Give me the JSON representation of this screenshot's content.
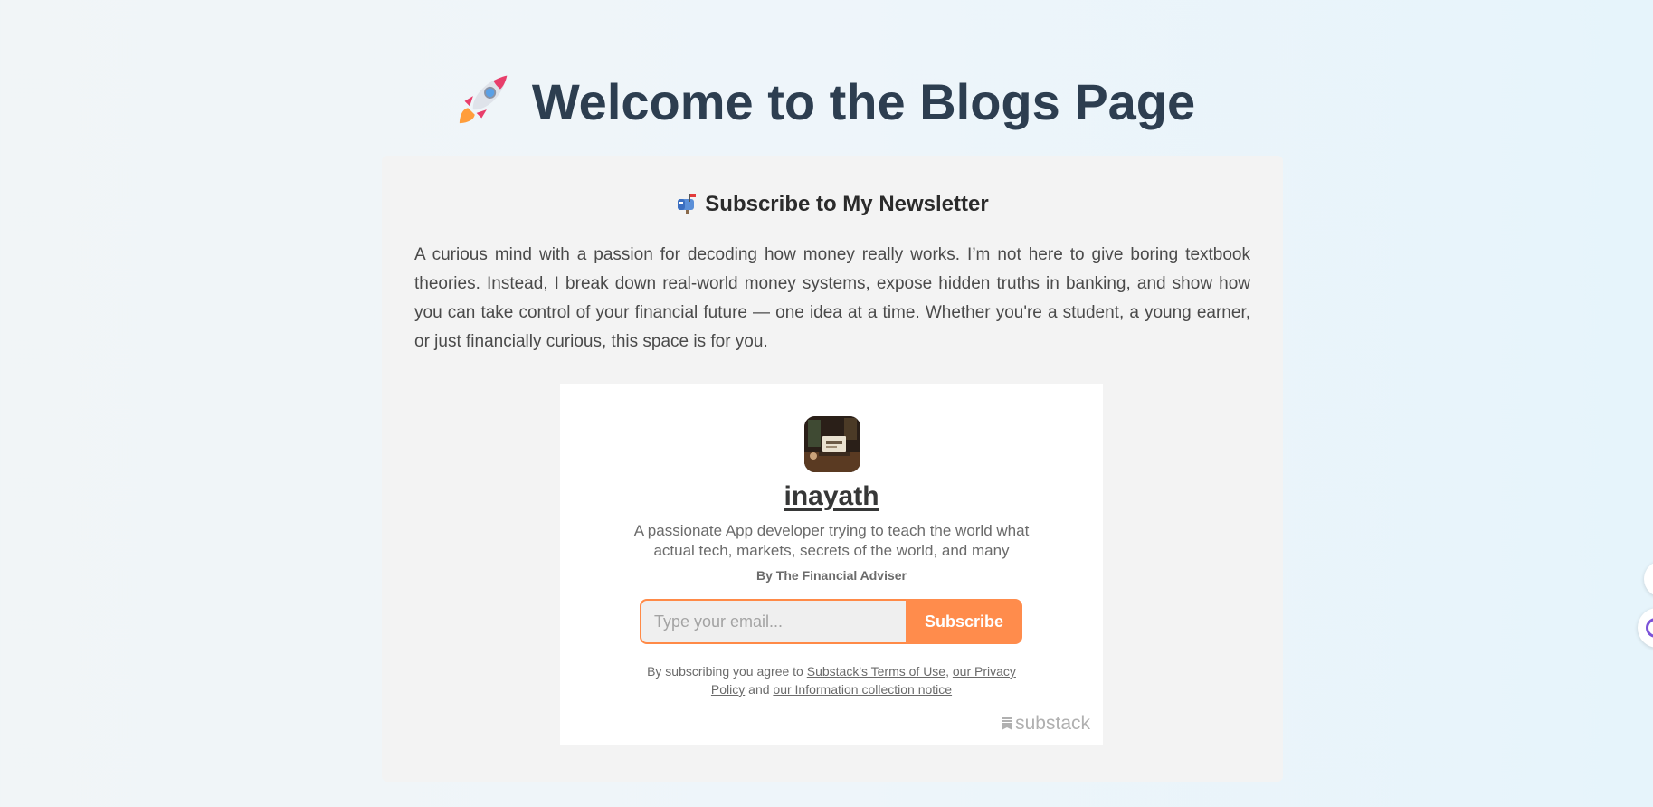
{
  "page": {
    "title": "Welcome to the Blogs Page",
    "title_icon": "rocket-icon"
  },
  "newsletter": {
    "heading": "Subscribe to My Newsletter",
    "heading_icon": "mailbox-icon",
    "description": "A curious mind with a passion for decoding how money really works. I’m not here to give boring textbook theories. Instead, I break down real-world money systems, expose hidden truths in banking, and show how you can take control of your financial future — one idea at a time. Whether you're a student, a young earner, or just financially curious, this space is for you."
  },
  "embed": {
    "publication_name": "inayath",
    "publication_description": "A passionate App developer trying to teach the world what actual tech, markets, secrets of the world, and many",
    "author_line": "By The Financial Adviser",
    "email_placeholder": "Type your email...",
    "subscribe_label": "Subscribe",
    "terms": {
      "prefix": "By subscribing you agree to ",
      "terms_link": "Substack's Terms of Use",
      "comma": ", ",
      "privacy_link": "our Privacy Policy",
      "and": " and ",
      "notice_link": "our Information collection notice"
    },
    "brand": "substack"
  },
  "colors": {
    "accent": "#ff8c4c",
    "title": "#2d3e50",
    "card_bg": "#f3f3f3",
    "widget_ring": "#7b52d8"
  }
}
